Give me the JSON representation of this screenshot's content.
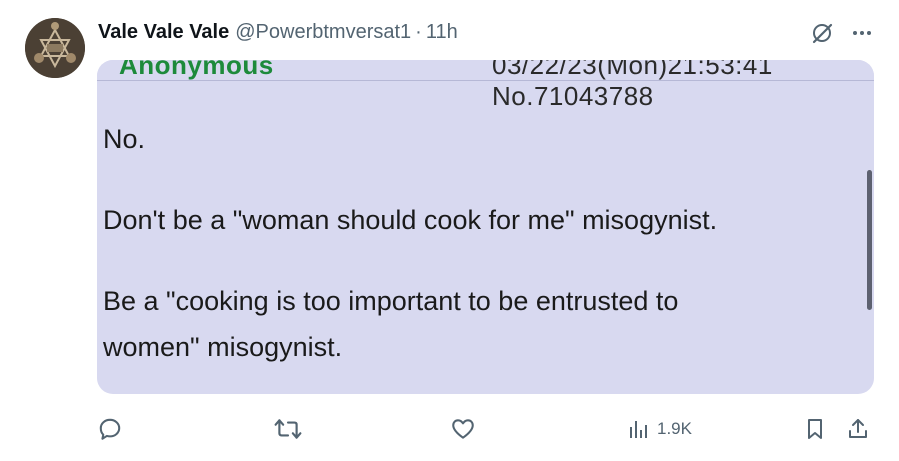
{
  "tweet": {
    "display_name": "Vale Vale Vale",
    "handle": "@Powerbtmversat1",
    "separator": "·",
    "time": "11h",
    "views": "1.9K"
  },
  "image": {
    "cut_name": "Anonymous",
    "cut_meta": "03/22/23(Mon)21:53:41 No.71043788",
    "lines": [
      "No.",
      "Don't be a \"woman should cook for me\" misogynist.",
      "Be a \"cooking is too important to be entrusted to",
      "women\" misogynist."
    ]
  },
  "icons": {
    "grok": "grok-icon",
    "more": "more-icon",
    "reply": "reply-icon",
    "retweet": "retweet-icon",
    "like": "heart-icon",
    "views": "views-icon",
    "bookmark": "bookmark-icon",
    "share": "share-icon"
  },
  "colors": {
    "text": "#0f1419",
    "muted": "#536471",
    "image_bg": "#d8d9f0",
    "name_green": "#1d8a3b"
  }
}
